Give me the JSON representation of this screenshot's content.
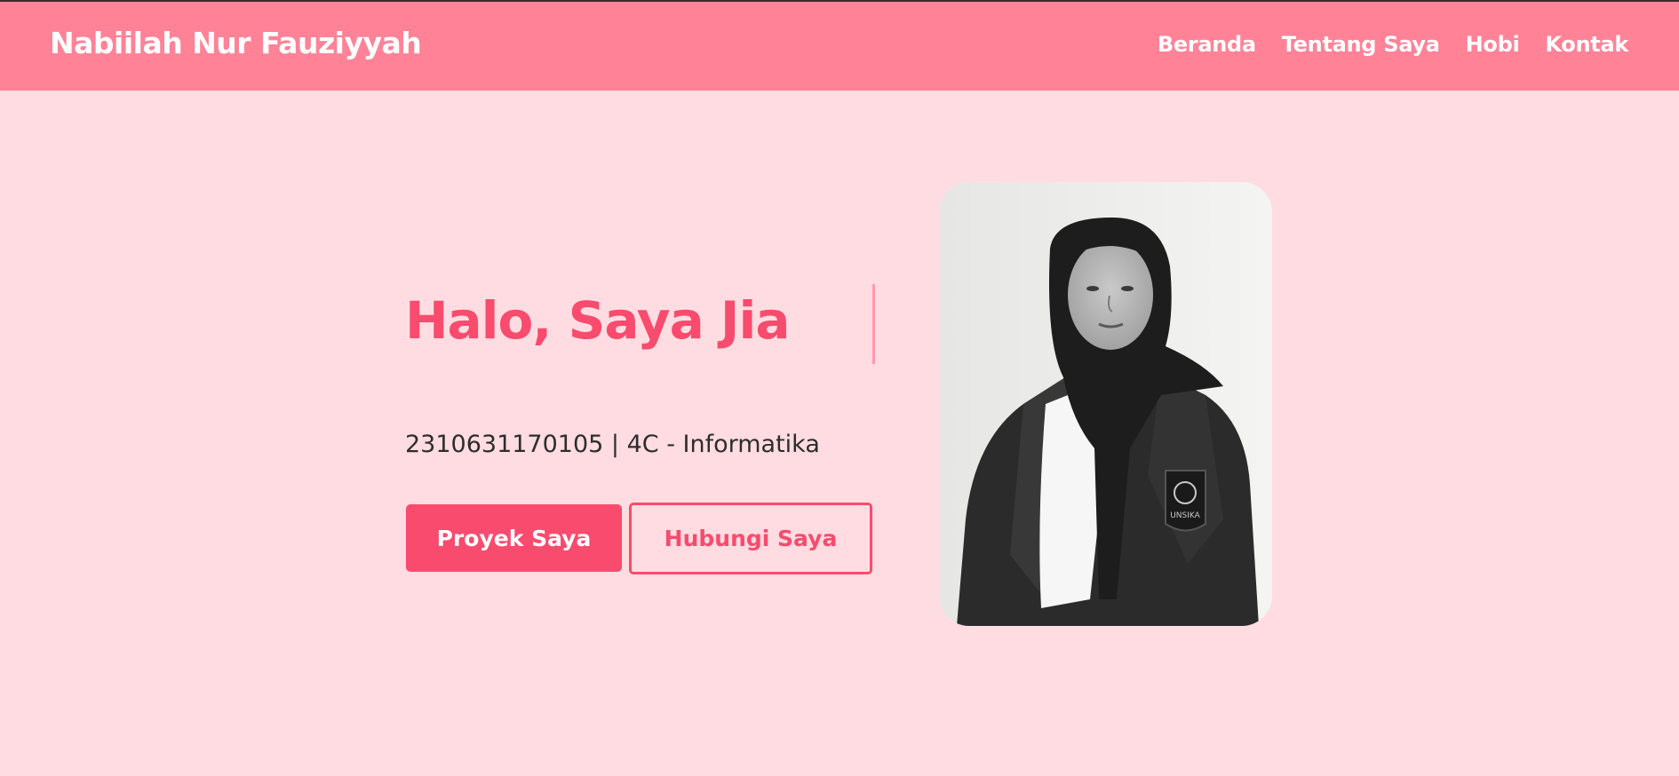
{
  "header": {
    "brand": "Nabiilah Nur Fauziyyah",
    "nav": [
      {
        "label": "Beranda"
      },
      {
        "label": "Tentang Saya"
      },
      {
        "label": "Hobi"
      },
      {
        "label": "Kontak"
      }
    ]
  },
  "hero": {
    "greeting": "Halo, Saya Jia",
    "subtitle": "2310631170105 | 4C - Informatika",
    "primary_button": "Proyek Saya",
    "secondary_button": "Hubungi Saya",
    "photo_badge": "UNSIKA"
  },
  "colors": {
    "navbar": "#ff8297",
    "background": "#ffdce1",
    "accent": "#f84b6d",
    "text": "#2d2d2d"
  }
}
